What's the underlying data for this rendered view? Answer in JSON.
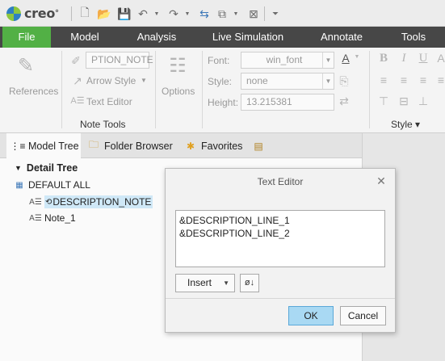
{
  "app": {
    "logo_text": "creo",
    "logo_suffix": "°"
  },
  "quick_access": {
    "icons": [
      "new-icon",
      "open-icon",
      "save-icon",
      "undo-icon",
      "redo-icon",
      "regenerate-icon",
      "windows-icon",
      "close-window-icon",
      "customize-icon"
    ]
  },
  "ribbon_tabs": [
    "File",
    "Model",
    "Analysis",
    "Live Simulation",
    "Annotate",
    "Tools"
  ],
  "ribbon": {
    "references_label": "References",
    "note_name_value": "PTION_NOTE",
    "arrow_style_label": "Arrow Style",
    "text_editor_label": "Text Editor",
    "options_label": "Options",
    "group_note_tools": "Note Tools",
    "font_label": "Font:",
    "font_value": "win_font",
    "style_label": "Style:",
    "style_value": "none",
    "height_label": "Height:",
    "height_value": "13.215381",
    "group_style": "Style ▾",
    "bold": "B",
    "italic": "I",
    "underline": "U"
  },
  "navigator": {
    "tabs": [
      "Model Tree",
      "Folder Browser",
      "Favorites"
    ],
    "tree_header": "Detail Tree",
    "items": [
      "DEFAULT ALL",
      "DESCRIPTION_NOTE",
      "Note_1"
    ]
  },
  "dialog": {
    "title": "Text Editor",
    "text_lines": [
      "&DESCRIPTION_LINE_1",
      "&DESCRIPTION_LINE_2"
    ],
    "insert_label": "Insert",
    "ok_label": "OK",
    "cancel_label": "Cancel"
  },
  "colors": {
    "active_tab": "#52b045",
    "tab_bar": "#474747",
    "selection": "#cfe8f7",
    "ok_button": "#a9d9f3"
  }
}
